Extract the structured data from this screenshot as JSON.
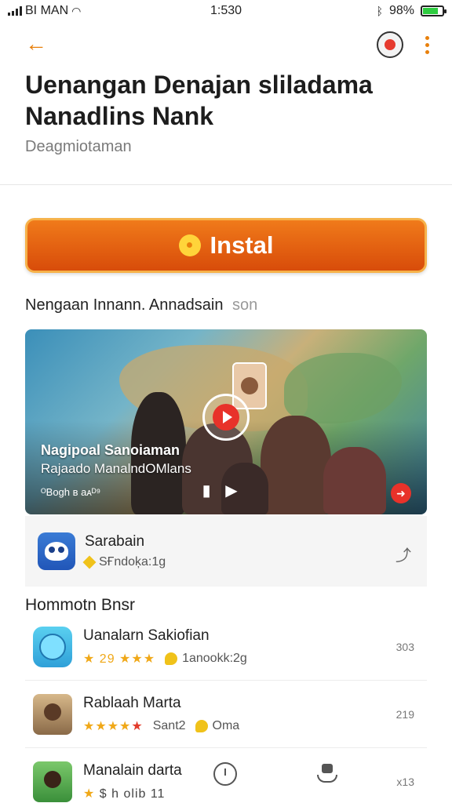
{
  "status_bar": {
    "carrier": "BI MAN",
    "time": "1:530",
    "battery": "98%",
    "icons": [
      "signal-icon",
      "wifi-icon",
      "bluetooth-icon",
      "battery-icon"
    ]
  },
  "header": {
    "title": "Uenangan Denajan sliladama Nanadlins Nank",
    "developer": "Deagmiotaman"
  },
  "install": {
    "label": "Instal"
  },
  "note": "Nengaan Innann. Annadsain",
  "note_suffix": "son",
  "video": {
    "title": "Nagipoal Sanoiaman",
    "subtitle": "Rajaado ManalndOMlans",
    "meta": "ᴼBogh ʙ aᴀᴰ⁹"
  },
  "featured": {
    "name": "Sarabain",
    "meta": "SҒndoķa:1g"
  },
  "section_heading": "Hommotn Bnsr",
  "list": [
    {
      "name": "Uanalarn Sakiofian",
      "rating": "29",
      "tag": "1anookk:2g",
      "right": "303"
    },
    {
      "name": "Rablaah Marta",
      "rating": "",
      "tag_a": "Sant2",
      "tag": "Oma",
      "right": "219"
    },
    {
      "name": "Manalain darta",
      "rating": "$ h olib 11",
      "tag": "",
      "right": "x13"
    }
  ],
  "colors": {
    "accent": "#e8800c",
    "install_top": "#f07a1a",
    "install_bottom": "#d84c0a",
    "star": "#f0a818",
    "play": "#e8322a"
  }
}
